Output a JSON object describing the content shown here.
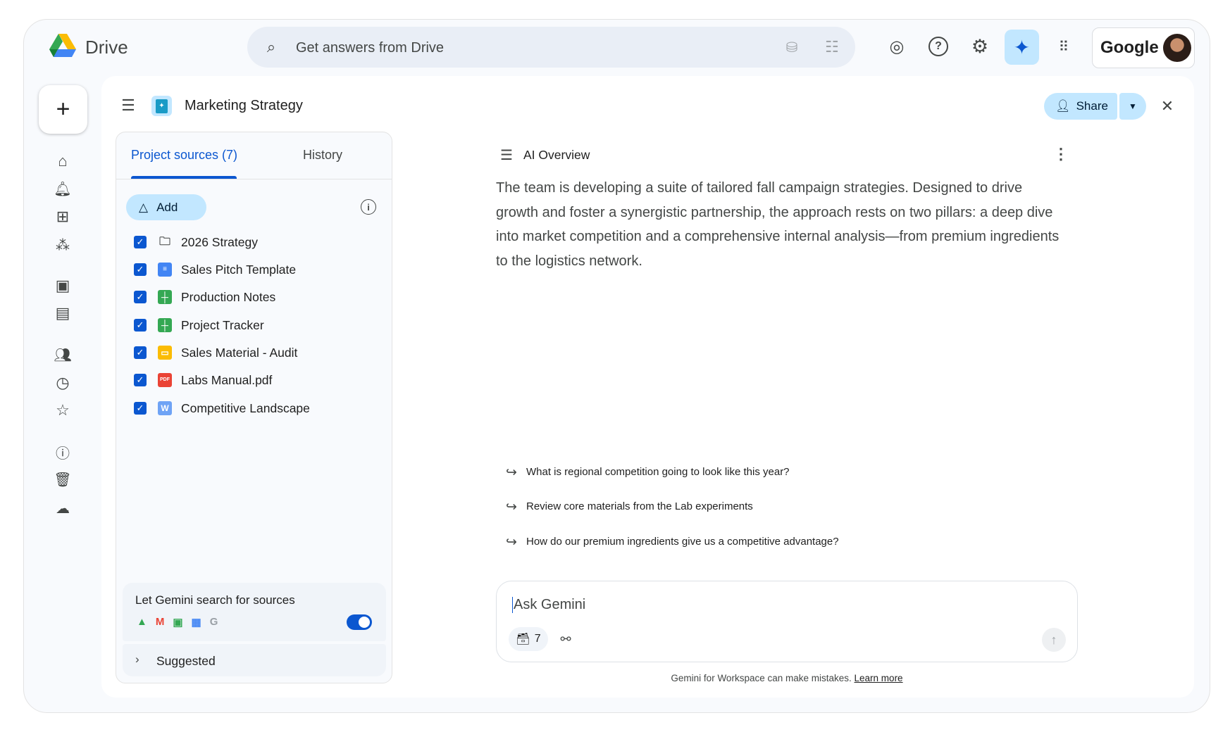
{
  "app": {
    "name": "Drive"
  },
  "search": {
    "placeholder": "Get answers from Drive"
  },
  "account": {
    "brand": "Google"
  },
  "header": {
    "title": "Marketing Strategy",
    "share_label": "Share"
  },
  "sources": {
    "tabs": [
      {
        "label": "Project sources (7)",
        "active": true
      },
      {
        "label": "History",
        "active": false
      }
    ],
    "add_label": "Add",
    "items": [
      {
        "label": "2026 Strategy",
        "type": "folder",
        "checked": true
      },
      {
        "label": "Sales Pitch Template",
        "type": "docs",
        "checked": true
      },
      {
        "label": "Production Notes",
        "type": "sheets",
        "checked": true
      },
      {
        "label": "Project Tracker",
        "type": "sheets",
        "checked": true
      },
      {
        "label": "Sales Material - Audit",
        "type": "slides",
        "checked": true
      },
      {
        "label": "Labs Manual.pdf",
        "type": "pdf",
        "checked": true
      },
      {
        "label": "Competitive Landscape",
        "type": "word",
        "checked": true
      }
    ],
    "gemini_search": {
      "label": "Let Gemini search for sources",
      "enabled": true
    },
    "suggested_label": "Suggested"
  },
  "overview": {
    "title": "AI Overview",
    "text": "The team is developing a suite of tailored fall campaign strategies. Designed to drive growth and foster a synergistic partnership, the approach rests on two pillars: a deep dive into market competition and a comprehensive internal analysis—from premium ingredients to the logistics network."
  },
  "suggestions": [
    "What is regional competition going to look like this year?",
    "Review core materials from the Lab experiments",
    "How do our premium ingredients give us a competitive advantage?"
  ],
  "ask": {
    "placeholder": "Ask Gemini",
    "source_count": "7"
  },
  "disclaimer": {
    "text": "Gemini for Workspace can make mistakes.",
    "link": "Learn more"
  },
  "colors": {
    "accent": "#0b57d0",
    "share_bg": "#c2e7ff",
    "gemini_bg": "#c2e7ff"
  }
}
